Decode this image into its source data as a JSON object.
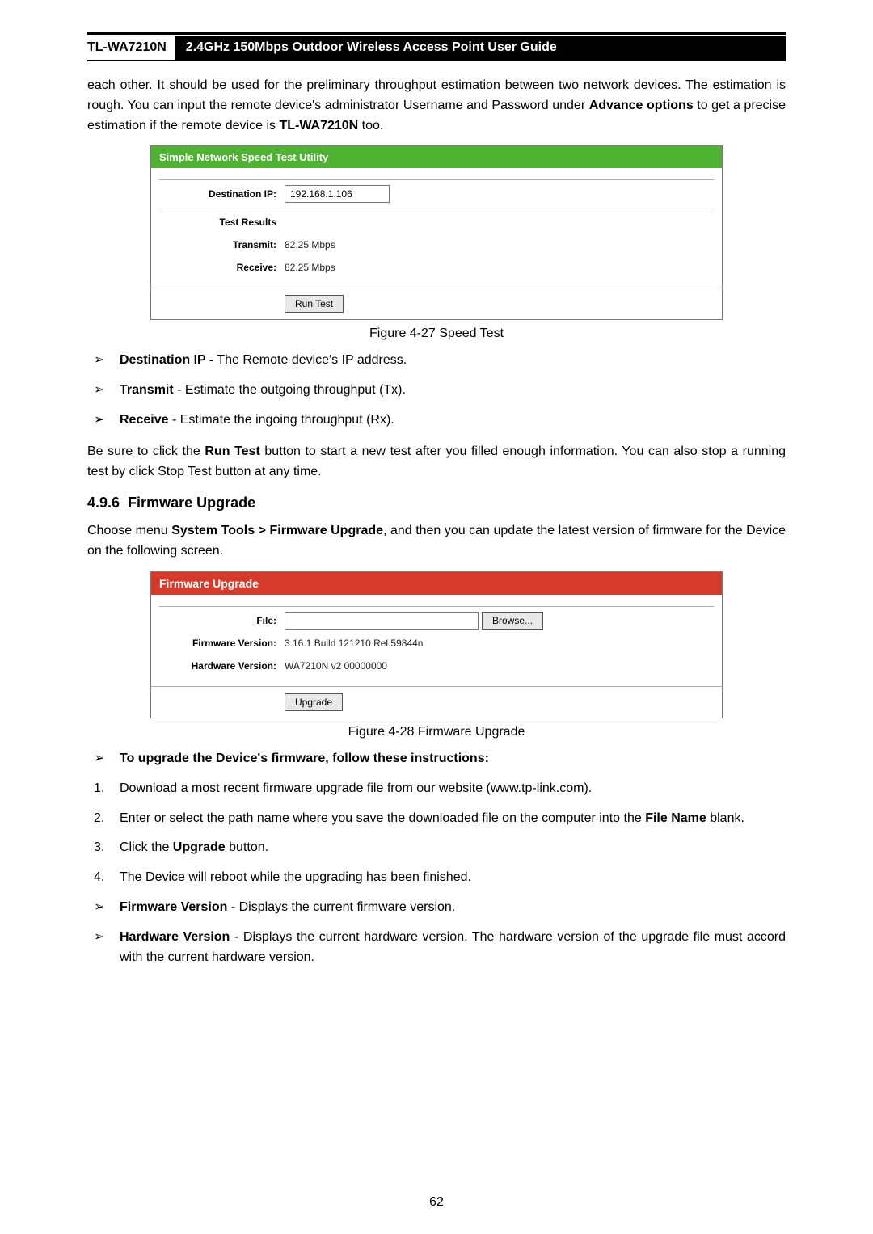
{
  "header": {
    "model": "TL-WA7210N",
    "title": "2.4GHz 150Mbps Outdoor Wireless Access Point User Guide"
  },
  "intro": {
    "p1_a": "each other. It should be used for the preliminary throughput estimation between two network devices. The estimation is rough. You can input the remote device's administrator Username and Password under ",
    "p1_b": "Advance options",
    "p1_c": " to get a precise estimation if the remote device is ",
    "p1_d": "TL-WA7210N",
    "p1_e": " too."
  },
  "speedtest": {
    "header": "Simple Network Speed Test Utility",
    "dest_ip_label": "Destination IP:",
    "dest_ip_value": "192.168.1.106",
    "results_label": "Test Results",
    "transmit_label": "Transmit:",
    "transmit_value": "82.25 Mbps",
    "receive_label": "Receive:",
    "receive_value": "82.25 Mbps",
    "run_btn": "Run Test",
    "caption": "Figure 4-27 Speed Test"
  },
  "defs": {
    "dest_bold": "Destination IP -",
    "dest_txt": " The Remote device's IP address.",
    "tx_bold": "Transmit",
    "tx_txt": " - Estimate the outgoing throughput (Tx).",
    "rx_bold": "Receive",
    "rx_txt": " - Estimate the ingoing throughput (Rx)."
  },
  "afterdefs": {
    "a": "Be sure to click the ",
    "b": "Run Test",
    "c": " button to start a new test after you filled enough information. You can also stop a running test by click Stop Test button at any time."
  },
  "section": {
    "number": "4.9.6",
    "title": "Firmware Upgrade",
    "intro_a": "Choose menu ",
    "intro_b": "System Tools > Firmware Upgrade",
    "intro_c": ", and then you can update the latest version of firmware for the Device on the following screen."
  },
  "firmware": {
    "header": "Firmware Upgrade",
    "file_label": "File:",
    "browse_btn": "Browse...",
    "fw_label": "Firmware Version:",
    "fw_value": "3.16.1 Build 121210 Rel.59844n",
    "hw_label": "Hardware Version:",
    "hw_value": "WA7210N v2 00000000",
    "upgrade_btn": "Upgrade",
    "caption": "Figure 4-28 Firmware Upgrade"
  },
  "instr": {
    "title": "To upgrade the Device's firmware, follow these instructions:",
    "s1": "Download a most recent firmware upgrade file from our website (www.tp-link.com).",
    "s2a": "Enter or select the path name where you save the downloaded file on the computer into the ",
    "s2b": "File Name",
    "s2c": " blank.",
    "s3a": "Click the ",
    "s3b": "Upgrade",
    "s3c": " button.",
    "s4": "The Device will reboot while the upgrading has been finished.",
    "fw_bold": "Firmware Version",
    "fw_txt": " - Displays the current firmware version.",
    "hw_bold": "Hardware Version",
    "hw_txt": " - Displays the current hardware version. The hardware version of the upgrade file must accord with the current hardware version."
  },
  "page_number": "62"
}
